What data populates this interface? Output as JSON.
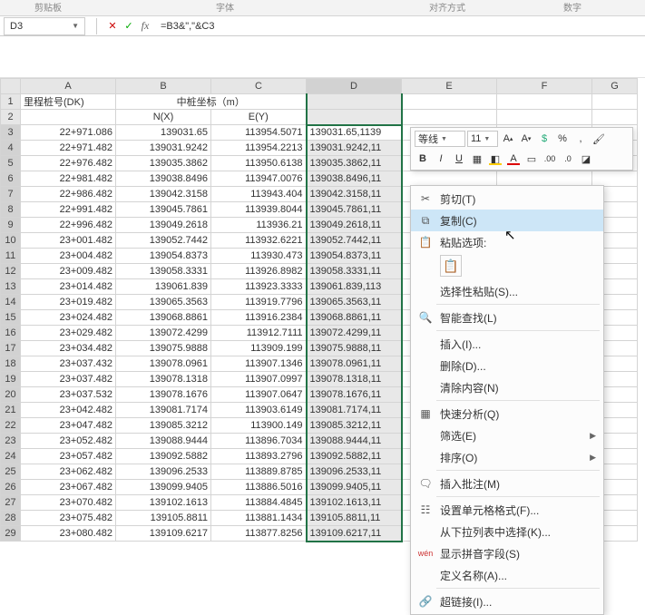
{
  "ribbon_hints": {
    "a": "剪贴板",
    "b": "字体",
    "c": "对齐方式",
    "d": "数字"
  },
  "name_box": "D3",
  "formula": "=B3&\",\"&C3",
  "columns": [
    "A",
    "B",
    "C",
    "D",
    "E",
    "F",
    "G"
  ],
  "row1": {
    "A": "里程桩号(DK)",
    "B_merged": "中桩坐标（m）"
  },
  "row2": {
    "B": "N(X)",
    "C": "E(Y)"
  },
  "rows": [
    {
      "n": 3,
      "A": "22+971.086",
      "B": "139031.65",
      "C": "113954.5071",
      "D": "139031.65,1139"
    },
    {
      "n": 4,
      "A": "22+971.482",
      "B": "139031.9242",
      "C": "113954.2213",
      "D": "139031.9242,11"
    },
    {
      "n": 5,
      "A": "22+976.482",
      "B": "139035.3862",
      "C": "113950.6138",
      "D": "139035.3862,11"
    },
    {
      "n": 6,
      "A": "22+981.482",
      "B": "139038.8496",
      "C": "113947.0076",
      "D": "139038.8496,11"
    },
    {
      "n": 7,
      "A": "22+986.482",
      "B": "139042.3158",
      "C": "113943.404",
      "D": "139042.3158,11"
    },
    {
      "n": 8,
      "A": "22+991.482",
      "B": "139045.7861",
      "C": "113939.8044",
      "D": "139045.7861,11"
    },
    {
      "n": 9,
      "A": "22+996.482",
      "B": "139049.2618",
      "C": "113936.21",
      "D": "139049.2618,11"
    },
    {
      "n": 10,
      "A": "23+001.482",
      "B": "139052.7442",
      "C": "113932.6221",
      "D": "139052.7442,11"
    },
    {
      "n": 11,
      "A": "23+004.482",
      "B": "139054.8373",
      "C": "113930.473",
      "D": "139054.8373,11"
    },
    {
      "n": 12,
      "A": "23+009.482",
      "B": "139058.3331",
      "C": "113926.8982",
      "D": "139058.3331,11"
    },
    {
      "n": 13,
      "A": "23+014.482",
      "B": "139061.839",
      "C": "113923.3333",
      "D": "139061.839,113"
    },
    {
      "n": 14,
      "A": "23+019.482",
      "B": "139065.3563",
      "C": "113919.7796",
      "D": "139065.3563,11"
    },
    {
      "n": 15,
      "A": "23+024.482",
      "B": "139068.8861",
      "C": "113916.2384",
      "D": "139068.8861,11"
    },
    {
      "n": 16,
      "A": "23+029.482",
      "B": "139072.4299",
      "C": "113912.7111",
      "D": "139072.4299,11"
    },
    {
      "n": 17,
      "A": "23+034.482",
      "B": "139075.9888",
      "C": "113909.199",
      "D": "139075.9888,11"
    },
    {
      "n": 18,
      "A": "23+037.432",
      "B": "139078.0961",
      "C": "113907.1346",
      "D": "139078.0961,11"
    },
    {
      "n": 19,
      "A": "23+037.482",
      "B": "139078.1318",
      "C": "113907.0997",
      "D": "139078.1318,11"
    },
    {
      "n": 20,
      "A": "23+037.532",
      "B": "139078.1676",
      "C": "113907.0647",
      "D": "139078.1676,11"
    },
    {
      "n": 21,
      "A": "23+042.482",
      "B": "139081.7174",
      "C": "113903.6149",
      "D": "139081.7174,11"
    },
    {
      "n": 22,
      "A": "23+047.482",
      "B": "139085.3212",
      "C": "113900.149",
      "D": "139085.3212,11"
    },
    {
      "n": 23,
      "A": "23+052.482",
      "B": "139088.9444",
      "C": "113896.7034",
      "D": "139088.9444,11"
    },
    {
      "n": 24,
      "A": "23+057.482",
      "B": "139092.5882",
      "C": "113893.2796",
      "D": "139092.5882,11"
    },
    {
      "n": 25,
      "A": "23+062.482",
      "B": "139096.2533",
      "C": "113889.8785",
      "D": "139096.2533,11"
    },
    {
      "n": 26,
      "A": "23+067.482",
      "B": "139099.9405",
      "C": "113886.5016",
      "D": "139099.9405,11"
    },
    {
      "n": 27,
      "A": "23+070.482",
      "B": "139102.1613",
      "C": "113884.4845",
      "D": "139102.1613,11"
    },
    {
      "n": 28,
      "A": "23+075.482",
      "B": "139105.8811",
      "C": "113881.1434",
      "D": "139105.8811,11"
    },
    {
      "n": 29,
      "A": "23+080.482",
      "B": "139109.6217",
      "C": "113877.8256",
      "D": "139109.6217,11"
    }
  ],
  "mini": {
    "font": "等线",
    "size": "11"
  },
  "ctx": {
    "cut": "剪切(T)",
    "copy": "复制(C)",
    "paste_options": "粘贴选项:",
    "paste_special": "选择性粘贴(S)...",
    "smart_lookup": "智能查找(L)",
    "insert": "插入(I)...",
    "delete": "删除(D)...",
    "clear_contents": "清除内容(N)",
    "quick_analysis": "快速分析(Q)",
    "filter": "筛选(E)",
    "sort": "排序(O)",
    "insert_comment": "插入批注(M)",
    "format_cells": "设置单元格格式(F)...",
    "pick_from_list": "从下拉列表中选择(K)...",
    "show_phonetic": "显示拼音字段(S)",
    "define_name": "定义名称(A)...",
    "hyperlink": "超链接(I)..."
  }
}
